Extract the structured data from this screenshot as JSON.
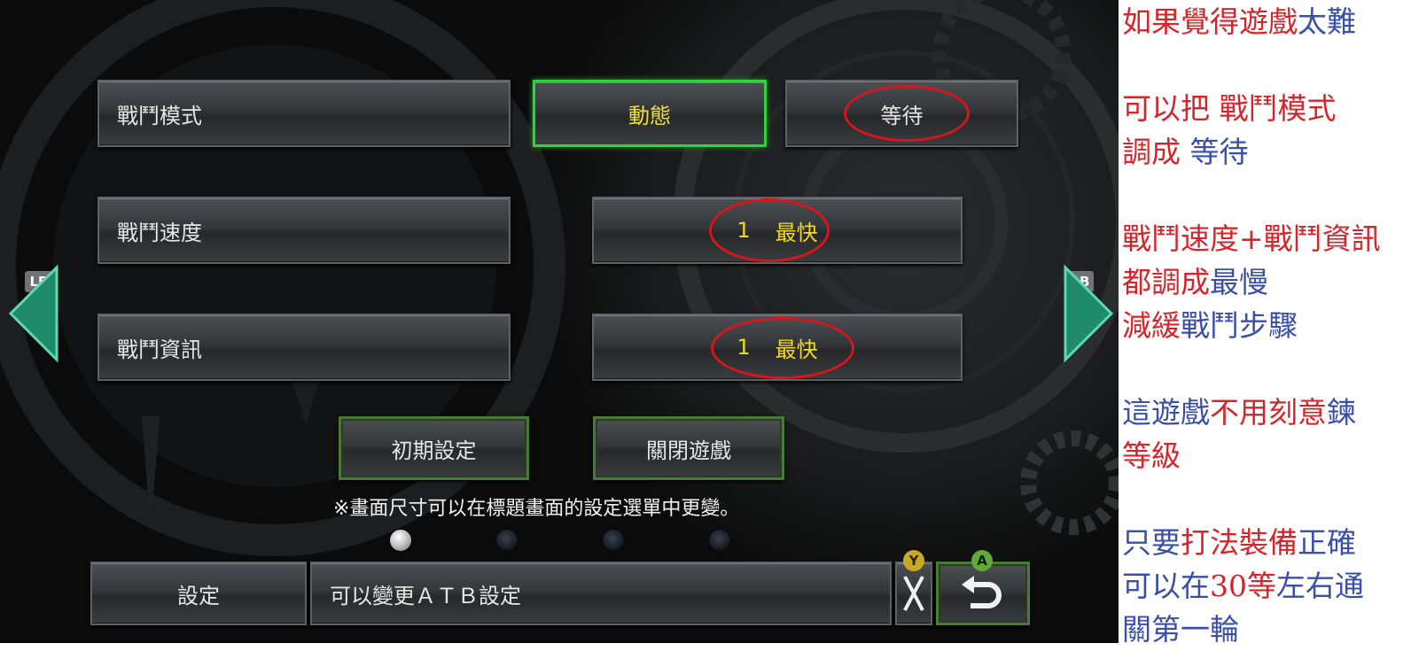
{
  "settings": {
    "battle_mode": {
      "label": "戰鬥模式",
      "options": [
        "動態",
        "等待"
      ],
      "selected": "動態"
    },
    "battle_speed": {
      "label": "戰鬥速度",
      "value_num": "1",
      "value_text": "最快"
    },
    "battle_info": {
      "label": "戰鬥資訊",
      "value_num": "1",
      "value_text": "最快"
    },
    "reset_label": "初期設定",
    "close_label": "關閉遊戲",
    "note": "※畫面尺寸可以在標題畫面的設定選單中更變。"
  },
  "pagination": {
    "pages": 4,
    "current": 1
  },
  "footer": {
    "title": "設定",
    "description": "可以變更ＡＴＢ設定",
    "y_badge": "Y",
    "a_badge": "A"
  },
  "nav": {
    "lb": "LB",
    "rb": "RB"
  },
  "colors": {
    "annotation_red": "#d6252a",
    "annotation_blue": "#3a4fa6",
    "selected_border": "#2fd43a",
    "value_yellow": "#f0d820"
  },
  "annotations": {
    "l1": {
      "a": "如果覺得遊戲",
      "b": "太難"
    },
    "l2": {
      "a": "可以把 戰鬥模式"
    },
    "l3": {
      "a": "調成",
      "b": " 等待"
    },
    "l4": {
      "a": "戰鬥速度+戰鬥資訊"
    },
    "l5": {
      "a": "都調成",
      "b": "最慢"
    },
    "l6": {
      "a": "減緩",
      "b": "戰鬥步驟"
    },
    "l7": {
      "a": "這遊戲",
      "b": "不用刻意",
      "c": "鍊"
    },
    "l8": {
      "a": "等級"
    },
    "l9": {
      "a": "只要",
      "b": "打法裝備",
      "c": "正確"
    },
    "l10": {
      "a": "可以在",
      "b": "30等",
      "c": "左右通"
    },
    "l11": {
      "a": "關第一輪"
    }
  }
}
